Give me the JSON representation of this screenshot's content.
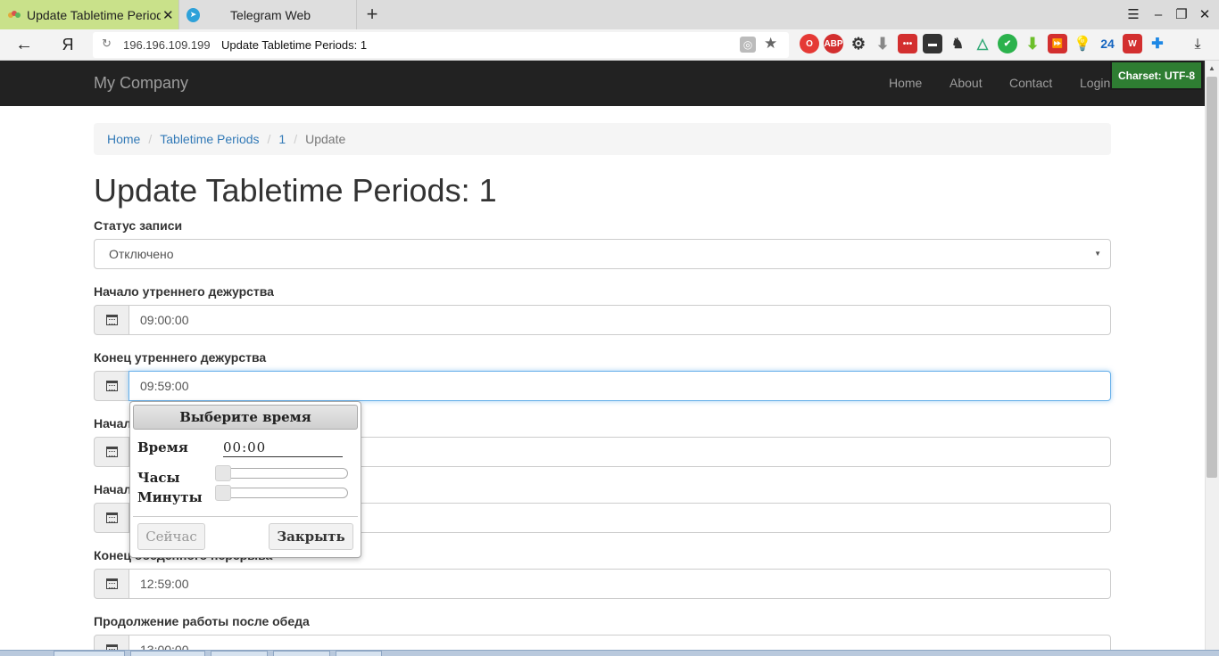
{
  "browser": {
    "tabs": [
      {
        "title": "Update Tabletime Periods: 1",
        "active": true
      },
      {
        "title": "Telegram Web",
        "active": false
      }
    ],
    "address": {
      "host": "196.196.109.199",
      "title": "Update Tabletime Periods: 1"
    },
    "yandex_label": "Я",
    "extensions_badge": "24"
  },
  "navbar": {
    "brand": "My Company",
    "links": [
      "Home",
      "About",
      "Contact",
      "Login"
    ],
    "charset_badge": "Charset: UTF-8"
  },
  "breadcrumb": {
    "items": [
      "Home",
      "Tabletime Periods",
      "1"
    ],
    "active": "Update"
  },
  "page_title": "Update Tabletime Periods: 1",
  "form": {
    "status_label": "Статус записи",
    "status_value": "Отключено",
    "fields": [
      {
        "label": "Начало утреннего дежурства",
        "value": "09:00:00"
      },
      {
        "label": "Конец утреннего дежурства",
        "value": "09:59:00"
      },
      {
        "label": "Начал",
        "value": ""
      },
      {
        "label": "Начал",
        "value": ""
      },
      {
        "label": "Конец обеденного перерыва",
        "value": "12:59:00"
      },
      {
        "label": "Продолжение работы после обеда",
        "value": "13:00:00"
      }
    ]
  },
  "timepicker": {
    "header": "Выберите время",
    "time_label": "Время",
    "time_value": "00:00",
    "hours_label": "Часы",
    "minutes_label": "Минуты",
    "hour_level": 0,
    "minute_level": 0,
    "now_button": "Сейчас",
    "close_button": "Закрыть"
  }
}
